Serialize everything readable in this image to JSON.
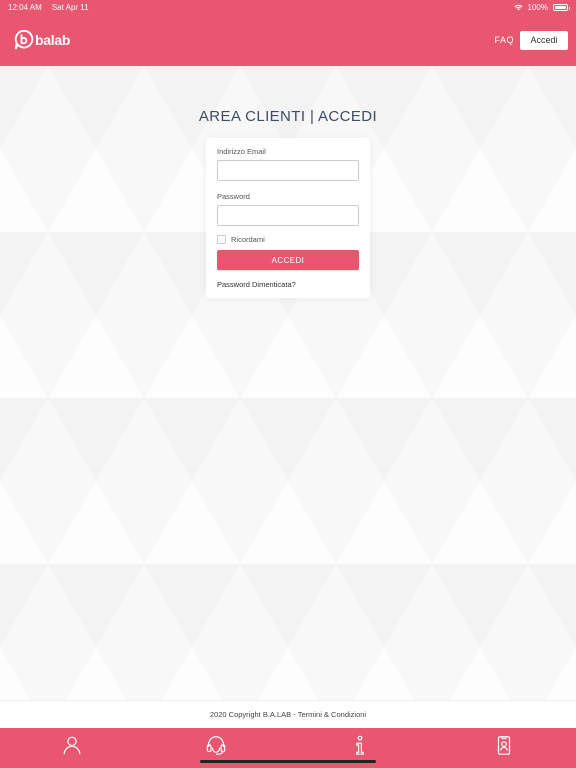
{
  "status_bar": {
    "time": "12:04 AM",
    "date": "Sat Apr 11",
    "battery": "100%",
    "battery_level": 1.0
  },
  "header": {
    "logo_text": "balab",
    "faq_label": "FAQ",
    "login_label": "Accedi"
  },
  "login": {
    "title": "AREA CLIENTI | ACCEDI",
    "email_label": "Indirizzo Email",
    "email_value": "",
    "password_label": "Password",
    "password_value": "",
    "remember_label": "Ricordami",
    "remember_checked": false,
    "submit_label": "ACCEDI",
    "forgot_label": "Password Dimenticata?"
  },
  "footer": {
    "copyright": "2020 Copyright B.A.LAB - Termini & Condizioni"
  },
  "tab_bar": {
    "items": [
      {
        "icon": "user-icon"
      },
      {
        "icon": "headset-icon"
      },
      {
        "icon": "info-icon"
      },
      {
        "icon": "badge-icon"
      }
    ]
  },
  "colors": {
    "brand": "#e8566f",
    "title": "#3d4a68"
  }
}
